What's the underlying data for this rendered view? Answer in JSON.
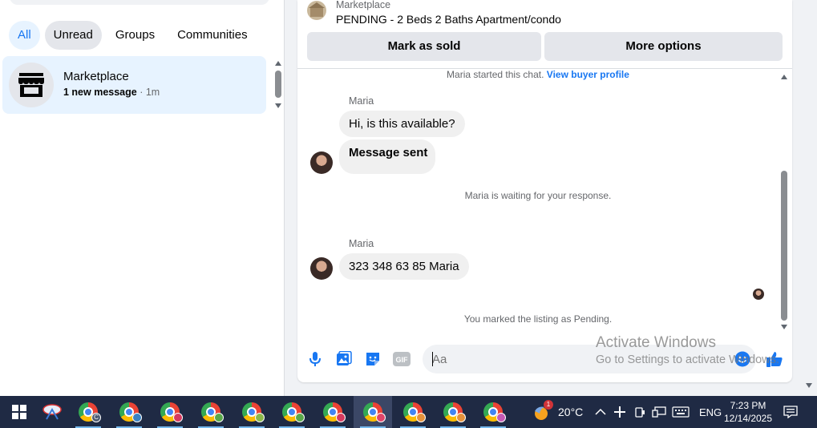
{
  "left": {
    "filters": [
      "All",
      "Unread",
      "Groups",
      "Communities"
    ],
    "conversation": {
      "name": "Marketplace",
      "preview": "1 new message",
      "time": "· 1m"
    }
  },
  "listing": {
    "kind": "Marketplace",
    "title": "PENDING - 2 Beds 2 Baths Apartment/condo",
    "mark_sold": "Mark as sold",
    "more_options": "More options"
  },
  "chat": {
    "started_text": "Maria started this chat.",
    "buyer_profile_link": "View buyer profile",
    "sender1": "Maria",
    "msg1": "Hi, is this available?",
    "msg2": "Message sent",
    "waiting_text": "Maria is waiting for your response.",
    "sender2": "Maria",
    "msg3": "323 348 63 85 Maria",
    "pending_text": "You marked the listing as Pending."
  },
  "composer": {
    "placeholder": "Aa",
    "icons": [
      "microphone-icon",
      "photo-icon",
      "sticker-icon",
      "gif-icon",
      "emoji-icon",
      "like-icon"
    ]
  },
  "watermark": {
    "line1": "Activate Windows",
    "line2": "Go to Settings to activate Windows."
  },
  "taskbar": {
    "weather_temp": "20°C",
    "weather_badge": "1",
    "language": "ENG",
    "time": "7:23 PM",
    "date": "12/14/2025",
    "profile_badges": [
      "C",
      "",
      "",
      "",
      "",
      "",
      "",
      "",
      "",
      "",
      ""
    ]
  },
  "colors": {
    "accent": "#1877f2",
    "bubble": "#f0f0f0",
    "taskbar": "#1f2a44"
  }
}
